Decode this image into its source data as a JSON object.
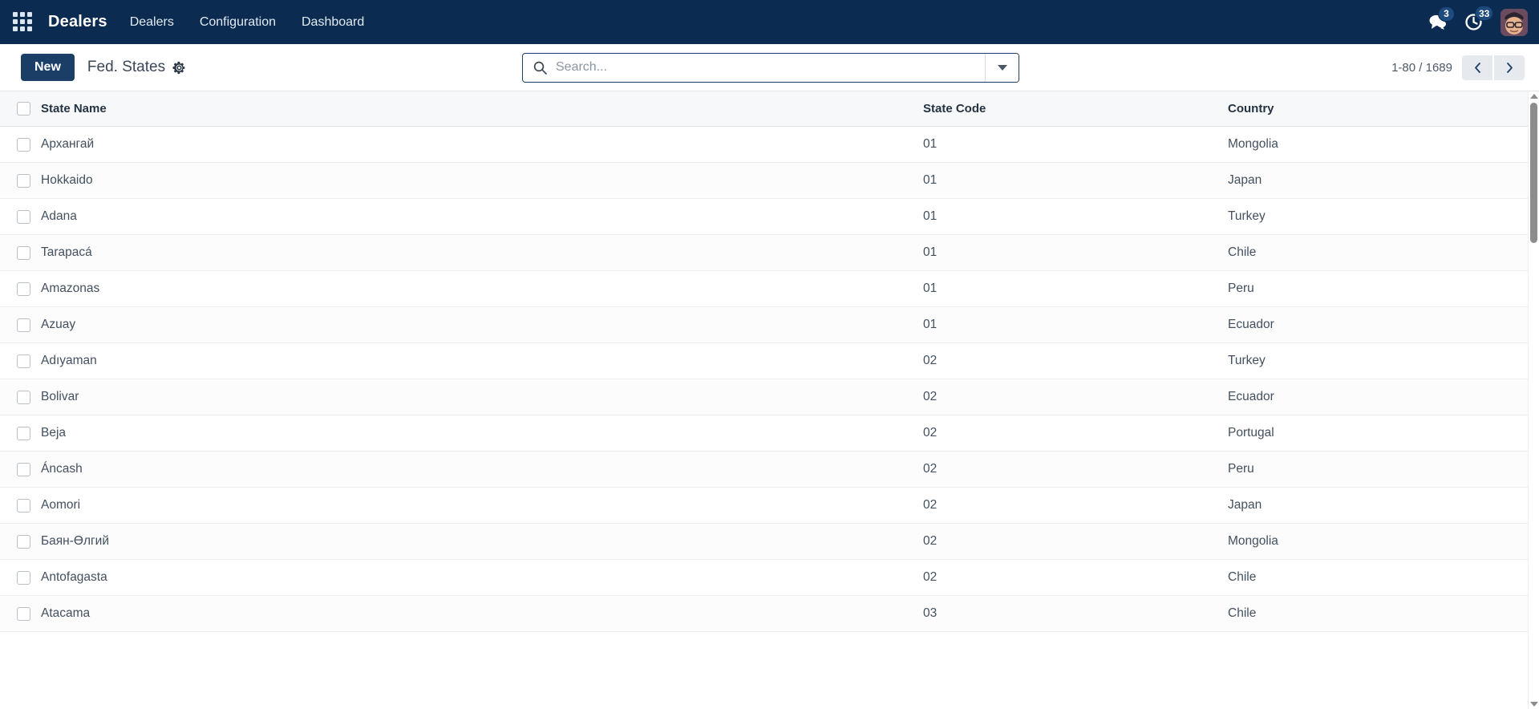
{
  "navbar": {
    "apps_icon": "apps-grid-icon",
    "brand": "Dealers",
    "menu": [
      {
        "label": "Dealers"
      },
      {
        "label": "Configuration"
      },
      {
        "label": "Dashboard"
      }
    ],
    "messages_icon": "chat-bubbles-icon",
    "messages_count": "3",
    "activities_icon": "clock-icon",
    "activities_count": "33",
    "avatar_icon": "user-avatar"
  },
  "control_panel": {
    "new_button": "New",
    "title": "Fed. States",
    "gear_icon": "gear-icon",
    "search": {
      "icon": "search-icon",
      "placeholder": "Search...",
      "value": "",
      "toggle_icon": "chevron-down-icon"
    },
    "pager": {
      "label": "1-80 / 1689",
      "prev_icon": "chevron-left-icon",
      "next_icon": "chevron-right-icon"
    }
  },
  "table": {
    "columns": [
      "State Name",
      "State Code",
      "Country"
    ],
    "rows": [
      {
        "name": "Архангай",
        "code": "01",
        "country": "Mongolia"
      },
      {
        "name": "Hokkaido",
        "code": "01",
        "country": "Japan"
      },
      {
        "name": "Adana",
        "code": "01",
        "country": "Turkey"
      },
      {
        "name": "Tarapacá",
        "code": "01",
        "country": "Chile"
      },
      {
        "name": "Amazonas",
        "code": "01",
        "country": "Peru"
      },
      {
        "name": "Azuay",
        "code": "01",
        "country": "Ecuador"
      },
      {
        "name": "Adıyaman",
        "code": "02",
        "country": "Turkey"
      },
      {
        "name": "Bolivar",
        "code": "02",
        "country": "Ecuador"
      },
      {
        "name": "Beja",
        "code": "02",
        "country": "Portugal"
      },
      {
        "name": "Áncash",
        "code": "02",
        "country": "Peru"
      },
      {
        "name": "Aomori",
        "code": "02",
        "country": "Japan"
      },
      {
        "name": "Баян-Өлгий",
        "code": "02",
        "country": "Mongolia"
      },
      {
        "name": "Antofagasta",
        "code": "02",
        "country": "Chile"
      },
      {
        "name": "Atacama",
        "code": "03",
        "country": "Chile"
      }
    ]
  },
  "colors": {
    "navbar_bg": "#0b2c50",
    "accent": "#1b3e66",
    "header_bg": "#f7f8fa",
    "text": "#43505f"
  }
}
